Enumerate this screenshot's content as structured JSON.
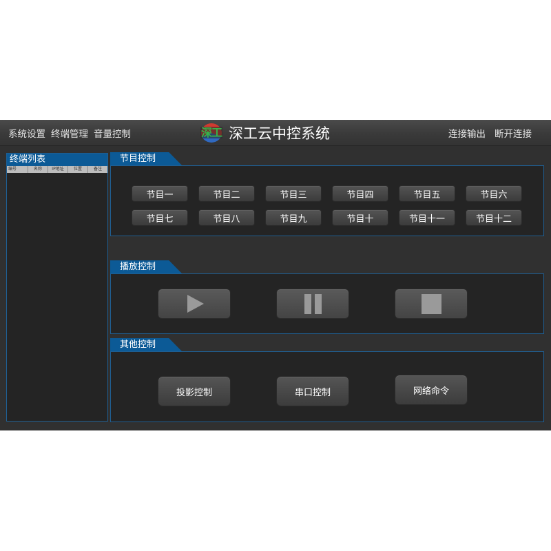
{
  "topbar": {
    "nav_left": [
      "系统设置",
      "终端管理",
      "音量控制"
    ],
    "nav_right": [
      "连接输出",
      "断开连接"
    ],
    "logo_text": "深工",
    "title": "深工云中控系统"
  },
  "terminal_list": {
    "title": "终端列表",
    "columns": [
      "编号",
      "名称",
      "IP地址",
      "位置",
      "备注"
    ]
  },
  "program_control": {
    "title": "节目控制",
    "buttons": [
      "节目一",
      "节目二",
      "节目三",
      "节目四",
      "节目五",
      "节目六",
      "节目七",
      "节目八",
      "节目九",
      "节目十",
      "节目十一",
      "节目十二"
    ]
  },
  "playback_control": {
    "title": "播放控制",
    "buttons": [
      "play-icon",
      "pause-icon",
      "stop-icon"
    ]
  },
  "other_control": {
    "title": "其他控制",
    "buttons": [
      "投影控制",
      "串口控制",
      "网络命令"
    ]
  },
  "colors": {
    "accent": "#0c5a96",
    "border": "#1f5f93",
    "background": "#303030",
    "panel": "#242424"
  }
}
